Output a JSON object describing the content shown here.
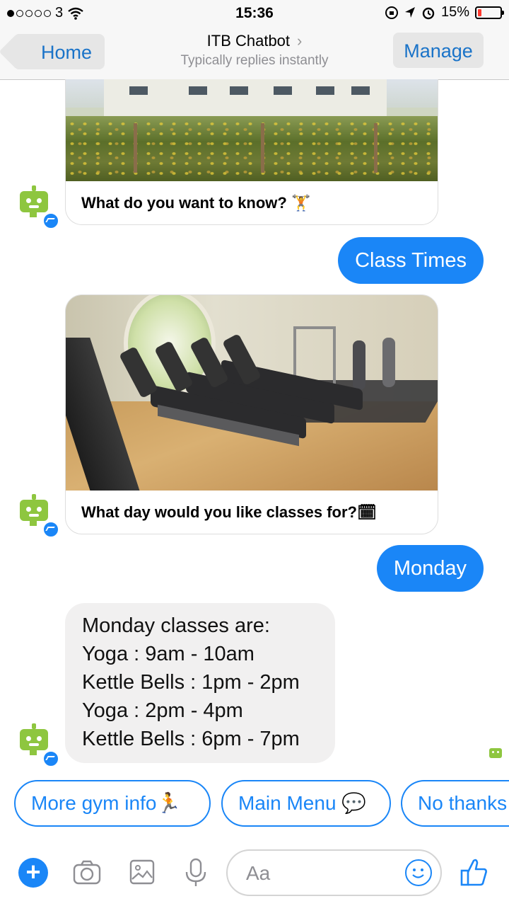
{
  "status_bar": {
    "carrier": "3",
    "time": "15:36",
    "battery": "15%",
    "signal_dots_full": 1,
    "signal_dots_total": 5
  },
  "nav": {
    "back_label": "Home",
    "title": "ITB Chatbot",
    "subtitle": "Typically replies instantly",
    "manage_label": "Manage"
  },
  "messages": {
    "card1_caption": "What do you want to know? 🏋",
    "user1": "Class Times",
    "card2_caption": "What day would you like classes for?🗓",
    "user2": "Monday",
    "bot_lines": [
      "Monday classes are:",
      "Yoga : 9am - 10am",
      "Kettle Bells : 1pm - 2pm",
      "Yoga : 2pm - 4pm",
      "Kettle Bells : 6pm - 7pm"
    ]
  },
  "quick_replies": [
    "More gym info🏃",
    "Main Menu 💬",
    "No thanks"
  ],
  "composer": {
    "plus": "+",
    "placeholder": "Aa"
  },
  "colors": {
    "accent": "#1a86f7",
    "bot_green": "#8ec63f",
    "bubble_grey": "#f1f0f0"
  }
}
